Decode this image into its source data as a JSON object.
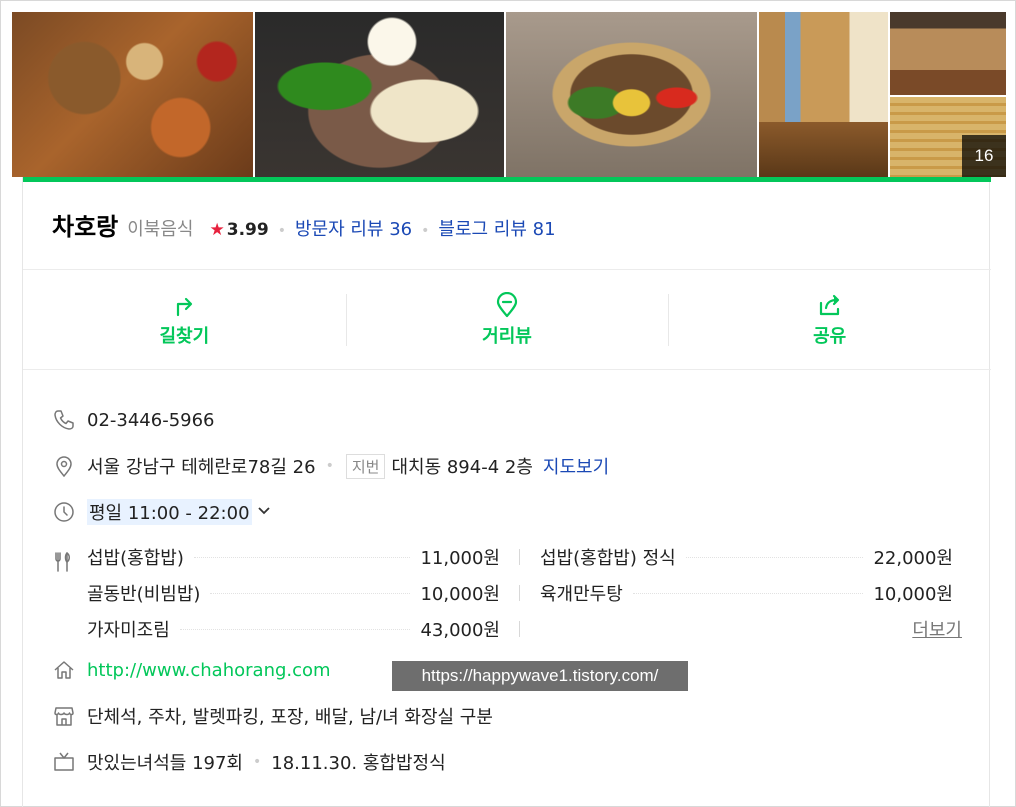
{
  "photos": {
    "count": "16"
  },
  "place": {
    "name": "차호랑",
    "category": "이북음식",
    "rating": "3.99",
    "visitor_reviews_label": "방문자 리뷰 36",
    "blog_reviews_label": "블로그 리뷰 81"
  },
  "actions": [
    {
      "label": "길찾기",
      "icon": "directions-icon"
    },
    {
      "label": "거리뷰",
      "icon": "street-view-icon"
    },
    {
      "label": "공유",
      "icon": "share-icon"
    }
  ],
  "info": {
    "phone": "02-3446-5966",
    "address": "서울 강남구 테헤란로78길 26",
    "lot_tag": "지번",
    "lot_address": "대치동 894-4 2층",
    "map_link": "지도보기",
    "hours": "평일 11:00 - 22:00",
    "menu": [
      {
        "name": "섭밥(홍합밥)",
        "price": "11,000원"
      },
      {
        "name": "섭밥(홍합밥) 정식",
        "price": "22,000원"
      },
      {
        "name": "골동반(비빔밥)",
        "price": "10,000원"
      },
      {
        "name": "육개만두탕",
        "price": "10,000원"
      },
      {
        "name": "가자미조림",
        "price": "43,000원"
      }
    ],
    "menu_more": "더보기",
    "website": "http://www.chahorang.com",
    "watermark": "https://happywave1.tistory.com/",
    "amenities": "단체석, 주차, 발렛파킹, 포장, 배달, 남/녀 화장실 구분",
    "tv_show": "맛있는녀석들 197회",
    "tv_episode": "18.11.30. 홍합밥정식"
  },
  "colors": {
    "brand_green": "#03c75a",
    "link_blue": "#1b49b5",
    "star_red": "#e7223e"
  }
}
